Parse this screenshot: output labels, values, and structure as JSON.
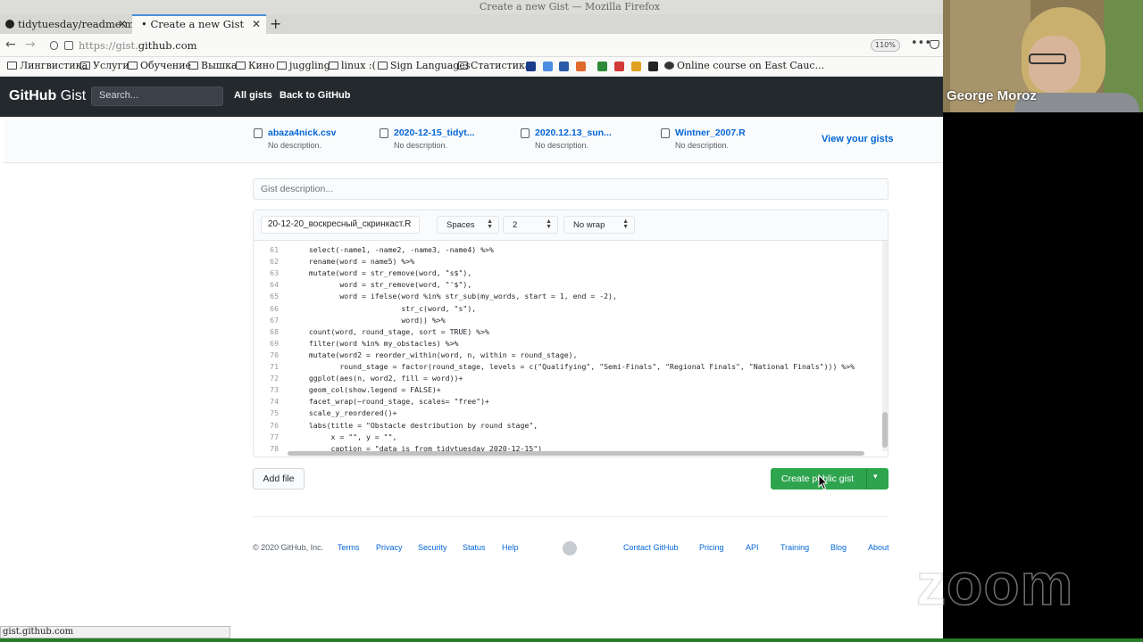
{
  "browser": {
    "window_title": "Create a new Gist — Mozilla Firefox",
    "tabs": [
      {
        "label": "tidytuesday/readme.md",
        "active": false
      },
      {
        "label": "Create a new Gist",
        "active": true
      }
    ],
    "url_prefix": "https://gist.",
    "url_domain": "github.com",
    "zoom": "110%",
    "bookmarks": [
      "Лингвистика",
      "Услуги",
      "Обучение",
      "Вышка",
      "Кино",
      "juggling",
      "linux :(",
      "Sign Languages",
      "Статистика",
      "Online course on East Cauc..."
    ],
    "status_url": "gist.github.com"
  },
  "header": {
    "logo_bold": "GitHub",
    "logo_rest": " Gist",
    "search_placeholder": "Search...",
    "links": [
      "All gists",
      "Back to GitHub"
    ]
  },
  "recent_gists": [
    {
      "name": "abaza4nick.csv",
      "desc": "No description."
    },
    {
      "name": "2020-12-15_tidyt...",
      "desc": "No description."
    },
    {
      "name": "2020.12.13_sun...",
      "desc": "No description."
    },
    {
      "name": "Wintner_2007.R",
      "desc": "No description."
    }
  ],
  "view_gists": "View your gists",
  "gist": {
    "description_placeholder": "Gist description...",
    "filename": "20-12-20_воскресный_скринкаст.R",
    "indent_mode": "Spaces",
    "indent_size": "2",
    "wrap_mode": "No wrap",
    "code_lines": [
      {
        "n": "61",
        "text": "  select(-name1, -name2, -name3, -name4) %>%"
      },
      {
        "n": "62",
        "text": "  rename(word = name5) %>%"
      },
      {
        "n": "63",
        "text": "  mutate(word = str_remove(word, \"s$\"),"
      },
      {
        "n": "64",
        "text": "         word = str_remove(word, \"'$\"),"
      },
      {
        "n": "65",
        "text": "         word = ifelse(word %in% str_sub(my_words, start = 1, end = -2),"
      },
      {
        "n": "66",
        "text": "                       str_c(word, \"s\"),"
      },
      {
        "n": "67",
        "text": "                       word)) %>%"
      },
      {
        "n": "68",
        "text": "  count(word, round_stage, sort = TRUE) %>%"
      },
      {
        "n": "69",
        "text": "  filter(word %in% my_obstacles) %>%"
      },
      {
        "n": "70",
        "text": "  mutate(word2 = reorder_within(word, n, within = round_stage),"
      },
      {
        "n": "71",
        "text": "         round_stage = factor(round_stage, levels = c(\"Qualifying\", \"Semi-Finals\", \"Regional Finals\", \"National Finals\"))) %>%"
      },
      {
        "n": "72",
        "text": "  ggplot(aes(n, word2, fill = word))+"
      },
      {
        "n": "73",
        "text": "  geom_col(show.legend = FALSE)+"
      },
      {
        "n": "74",
        "text": "  facet_wrap(~round_stage, scales= \"free\")+"
      },
      {
        "n": "75",
        "text": "  scale_y_reordered()+"
      },
      {
        "n": "76",
        "text": "  labs(title = \"Obstacle destribution by round stage\","
      },
      {
        "n": "77",
        "text": "       x = \"\", y = \"\","
      },
      {
        "n": "78",
        "text": "       caption = \"data is from tidytuesday 2020-12-15\")"
      }
    ],
    "add_file": "Add file",
    "create_button": "Create public gist"
  },
  "footer": {
    "copyright": "© 2020 GitHub, Inc.",
    "left_links": [
      "Terms",
      "Privacy",
      "Security",
      "Status",
      "Help"
    ],
    "right_links": [
      "Contact GitHub",
      "Pricing",
      "API",
      "Training",
      "Blog",
      "About"
    ]
  },
  "zoom_overlay": {
    "participant_name": "George Moroz",
    "watermark": "zoom"
  }
}
